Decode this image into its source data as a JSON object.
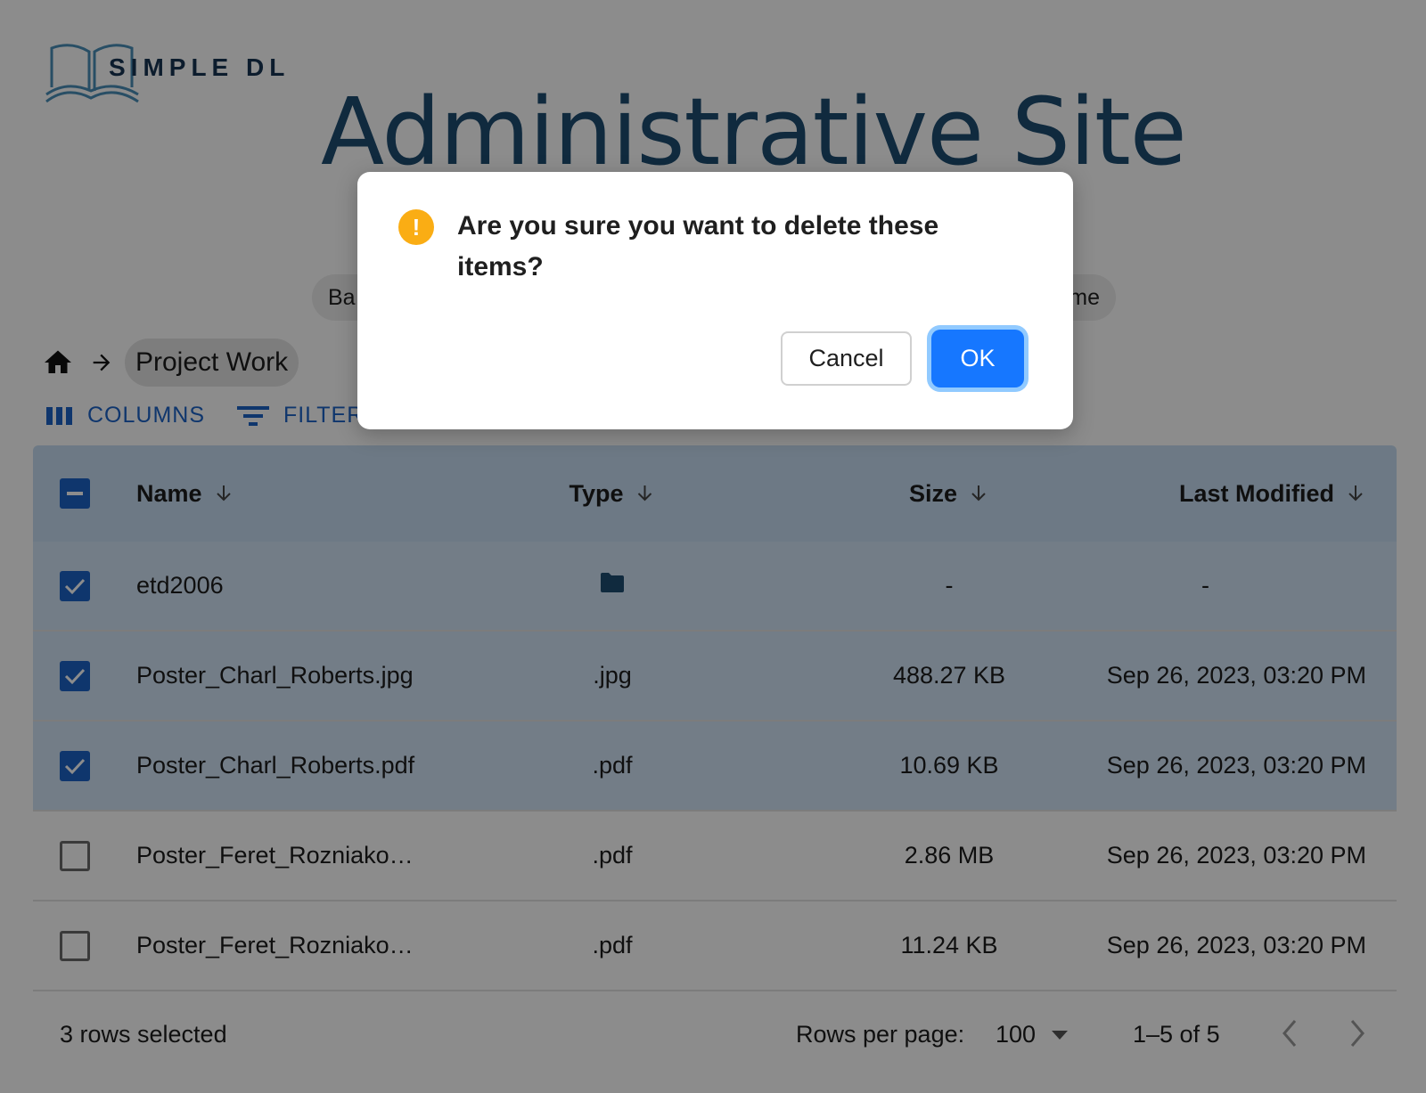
{
  "logo": {
    "text": "SIMPLE DL"
  },
  "header": {
    "title": "Administrative Site"
  },
  "nav": {
    "left_fragment": "Ba",
    "right_fragment": "me"
  },
  "breadcrumb": {
    "current": "Project Work"
  },
  "toolbar": {
    "columns_label": "COLUMNS",
    "filters_label": "FILTERS"
  },
  "table": {
    "headers": {
      "name": "Name",
      "type": "Type",
      "size": "Size",
      "modified": "Last Modified"
    },
    "rows": [
      {
        "name": "etd2006",
        "type": "folder",
        "size": "-",
        "modified": "-",
        "selected": true
      },
      {
        "name": "Poster_Charl_Roberts.jpg",
        "type": ".jpg",
        "size": "488.27 KB",
        "modified": "Sep 26, 2023, 03:20 PM",
        "selected": true
      },
      {
        "name": "Poster_Charl_Roberts.pdf",
        "type": ".pdf",
        "size": "10.69 KB",
        "modified": "Sep 26, 2023, 03:20 PM",
        "selected": true
      },
      {
        "name": "Poster_Feret_Rozniako…",
        "type": ".pdf",
        "size": "2.86 MB",
        "modified": "Sep 26, 2023, 03:20 PM",
        "selected": false
      },
      {
        "name": "Poster_Feret_Rozniako…",
        "type": ".pdf",
        "size": "11.24 KB",
        "modified": "Sep 26, 2023, 03:20 PM",
        "selected": false
      }
    ]
  },
  "footer": {
    "selected_text": "3 rows selected",
    "rows_per_page_label": "Rows per page:",
    "rows_per_page_value": "100",
    "range_text": "1–5 of 5"
  },
  "modal": {
    "message": "Are you sure you want to delete these items?",
    "cancel_label": "Cancel",
    "ok_label": "OK",
    "icon": "warning-icon"
  },
  "colors": {
    "primary": "#1d63c7",
    "ok_button": "#1677ff",
    "warning": "#faad14",
    "title": "#1e4d72",
    "header_bg": "#c7dcf3",
    "selected_row_bg": "#d2e4f6"
  }
}
